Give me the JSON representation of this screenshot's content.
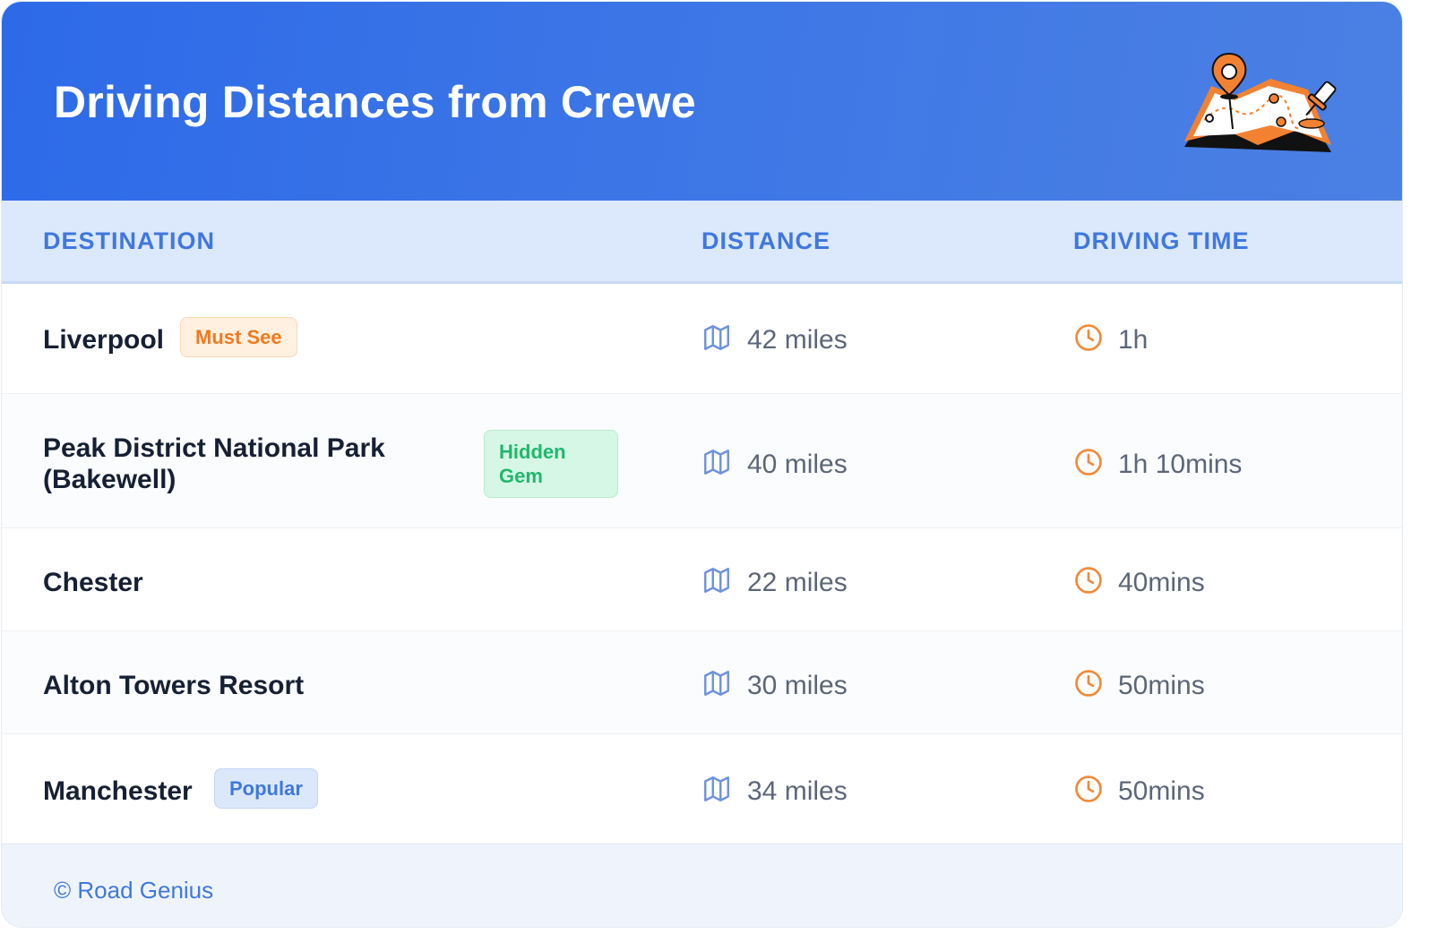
{
  "header": {
    "title": "Driving Distances from Crewe"
  },
  "table": {
    "columns": {
      "destination": "DESTINATION",
      "distance": "DISTANCE",
      "driving_time": "DRIVING TIME"
    },
    "rows": [
      {
        "destination": "Liverpool",
        "badge": "Must See",
        "distance": "42 miles",
        "time": "1h"
      },
      {
        "destination_line1": "Peak District National Park",
        "destination_line2": "(Bakewell)",
        "badge_line1": "Hidden",
        "badge_line2": "Gem",
        "distance": "40 miles",
        "time": "1h 10mins"
      },
      {
        "destination": "Chester",
        "distance": "22 miles",
        "time": "40mins"
      },
      {
        "destination": "Alton Towers Resort",
        "distance": "30 miles",
        "time": "50mins"
      },
      {
        "destination": "Manchester",
        "badge": "Popular",
        "distance": "34 miles",
        "time": "50mins"
      }
    ]
  },
  "icons": {
    "header_illustration": "map-with-pins-icon",
    "distance": "map-icon",
    "time": "clock-icon"
  },
  "colors": {
    "header_bg": "#2d6ae8",
    "accent_blue": "#3f78de",
    "accent_orange": "#ef7a20",
    "accent_green": "#21b86c"
  },
  "footer": {
    "text": "© Road Genius"
  }
}
